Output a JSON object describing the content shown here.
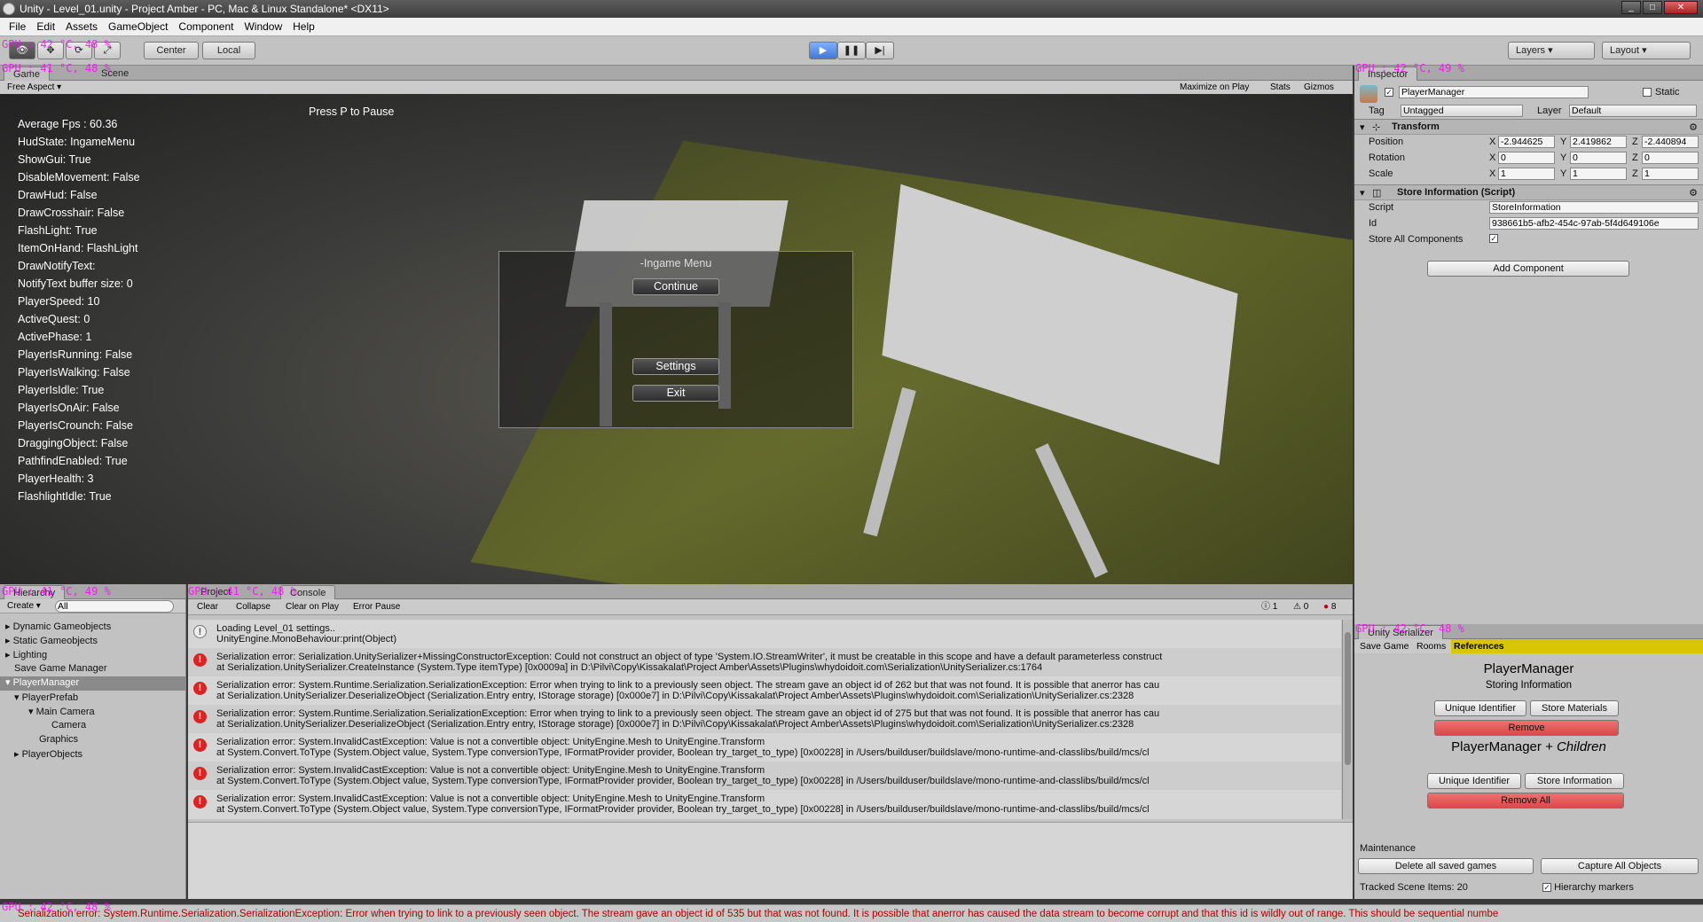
{
  "window": {
    "title": "Unity - Level_01.unity - Project Amber - PC, Mac & Linux Standalone* <DX11>"
  },
  "menu": [
    "File",
    "Edit",
    "Assets",
    "GameObject",
    "Component",
    "Window",
    "Help"
  ],
  "toolbar": {
    "center": "Center",
    "local": "Local",
    "layers": "Layers",
    "layout": "Layout"
  },
  "overlay": {
    "gpu_a": "GPU : 42 °C, 48 %",
    "gpu_b": "GPU : 41 °C, 48 %",
    "gpu_c": "GPU : 42 °C, 49 %",
    "gpu_d": "GPU : 41 °C, 49 %",
    "gpu_e": "GPU : 41 °C, 48 %",
    "gpu_f": "GPU : 42 °C, 48 %",
    "gpu_g": "GPU : 42 °C, 48 %"
  },
  "game": {
    "tab_game": "Game",
    "tab_scene": "Scene",
    "aspect": "Free Aspect",
    "maximize": "Maximize on Play",
    "stats": "Stats",
    "gizmos": "Gizmos",
    "press_p": "Press P to Pause",
    "debug": [
      "Average Fps : 60.36",
      "HudState: IngameMenu",
      "ShowGui: True",
      "DisableMovement: False",
      "DrawHud: False",
      "DrawCrosshair: False",
      "FlashLight: True",
      "ItemOnHand: FlashLight",
      "DrawNotifyText:",
      "NotifyText buffer size: 0",
      "PlayerSpeed: 10",
      "ActiveQuest: 0",
      "ActivePhase: 1",
      "PlayerIsRunning: False",
      "PlayerIsWalking: False",
      "PlayerIsIdle: True",
      "PlayerIsOnAir: False",
      "PlayerIsCrounch: False",
      "DraggingObject: False",
      "PathfindEnabled: True",
      "PlayerHealth: 3",
      "FlashlightIdle: True"
    ],
    "menu_title": "-Ingame Menu",
    "continue": "Continue",
    "settings": "Settings",
    "exit": "Exit"
  },
  "inspector": {
    "tab": "Inspector",
    "name": "PlayerManager",
    "static": "Static",
    "tag_label": "Tag",
    "tag": "Untagged",
    "layer_label": "Layer",
    "layer": "Default",
    "transform": "Transform",
    "position": "Position",
    "rotation": "Rotation",
    "scale": "Scale",
    "px": "-2.944625",
    "py": "2.419862",
    "pz": "-2.440894",
    "rx": "0",
    "ry": "0",
    "rz": "0",
    "sx": "1",
    "sy": "1",
    "sz": "1",
    "script_comp": "Store Information (Script)",
    "script_label": "Script",
    "script": "StoreInformation",
    "id_label": "Id",
    "id": "938661b5-afb2-454c-97ab-5f4d649106e",
    "store_all": "Store All Components",
    "add_component": "Add Component"
  },
  "hierarchy": {
    "tab": "Hierarchy",
    "create": "Create",
    "search": "All",
    "items": [
      "Dynamic Gameobjects",
      "Static Gameobjects",
      "Lighting",
      "Save Game Manager",
      "PlayerManager",
      "PlayerPrefab",
      "Main Camera",
      "Camera",
      "Graphics",
      "PlayerObjects"
    ]
  },
  "console": {
    "tab_project": "Project",
    "tab_console": "Console",
    "clear": "Clear",
    "collapse": "Collapse",
    "clear_on_play": "Clear on Play",
    "error_pause": "Error Pause",
    "n_info": "1",
    "n_warn": "0",
    "n_err": "8",
    "entries": [
      {
        "l1": "Loading Level_01 settings..",
        "l2": "UnityEngine.MonoBehaviour:print(Object)"
      },
      {
        "l1": "Serialization error: Serialization.UnitySerializer+MissingConstructorException: Could not construct an object of type 'System.IO.StreamWriter', it must be creatable in this scope and have a default parameterless construct",
        "l2": "  at Serialization.UnitySerializer.CreateInstance (System.Type itemType) [0x0009a] in D:\\Pilvi\\Copy\\Kissakalat\\Project Amber\\Assets\\Plugins\\whydoidoit.com\\Serialization\\UnitySerializer.cs:1764"
      },
      {
        "l1": "Serialization error: System.Runtime.Serialization.SerializationException: Error when trying to link to a previously seen object. The stream gave an object id of 262 but that was not found.  It is possible that anerror has cau",
        "l2": "  at Serialization.UnitySerializer.DeserializeObject (Serialization.Entry entry, IStorage storage) [0x000e7] in D:\\Pilvi\\Copy\\Kissakalat\\Project Amber\\Assets\\Plugins\\whydoidoit.com\\Serialization\\UnitySerializer.cs:2328"
      },
      {
        "l1": "Serialization error: System.Runtime.Serialization.SerializationException: Error when trying to link to a previously seen object. The stream gave an object id of 275 but that was not found.  It is possible that anerror has cau",
        "l2": "  at Serialization.UnitySerializer.DeserializeObject (Serialization.Entry entry, IStorage storage) [0x000e7] in D:\\Pilvi\\Copy\\Kissakalat\\Project Amber\\Assets\\Plugins\\whydoidoit.com\\Serialization\\UnitySerializer.cs:2328"
      },
      {
        "l1": "Serialization error: System.InvalidCastException: Value is not a convertible object: UnityEngine.Mesh to UnityEngine.Transform",
        "l2": "  at System.Convert.ToType (System.Object value, System.Type conversionType, IFormatProvider provider, Boolean try_target_to_type) [0x00228] in /Users/builduser/buildslave/mono-runtime-and-classlibs/build/mcs/cl"
      },
      {
        "l1": "Serialization error: System.InvalidCastException: Value is not a convertible object: UnityEngine.Mesh to UnityEngine.Transform",
        "l2": "  at System.Convert.ToType (System.Object value, System.Type conversionType, IFormatProvider provider, Boolean try_target_to_type) [0x00228] in /Users/builduser/buildslave/mono-runtime-and-classlibs/build/mcs/cl"
      },
      {
        "l1": "Serialization error: System.InvalidCastException: Value is not a convertible object: UnityEngine.Mesh to UnityEngine.Transform",
        "l2": "  at System.Convert.ToType (System.Object value, System.Type conversionType, IFormatProvider provider, Boolean try_target_to_type) [0x00228] in /Users/builduser/buildslave/mono-runtime-and-classlibs/build/mcs/cl"
      }
    ]
  },
  "serializer": {
    "tab": "Unity Serializer",
    "tab_save": "Save Game",
    "tab_rooms": "Rooms",
    "tab_refs": "References",
    "title": "PlayerManager",
    "subtitle": "Storing Information",
    "unique_id": "Unique Identifier",
    "store_materials": "Store Materials",
    "remove": "Remove",
    "children_title": "PlayerManager",
    "children_suffix": "+ Children",
    "store_info": "Store Information",
    "remove_all": "Remove All",
    "maintenance": "Maintenance",
    "delete_all": "Delete all saved games",
    "capture_all": "Capture All Objects",
    "tracked": "Tracked Scene Items: 20",
    "hier_markers": "Hierarchy markers"
  },
  "status": "Serialization error: System.Runtime.Serialization.SerializationException: Error when trying to link to a previously seen object. The stream gave an object id of 535 but that was not found.  It is possible that anerror has caused the data stream to become corrupt and that this id is wildly out of range.  This should be sequential numbe"
}
